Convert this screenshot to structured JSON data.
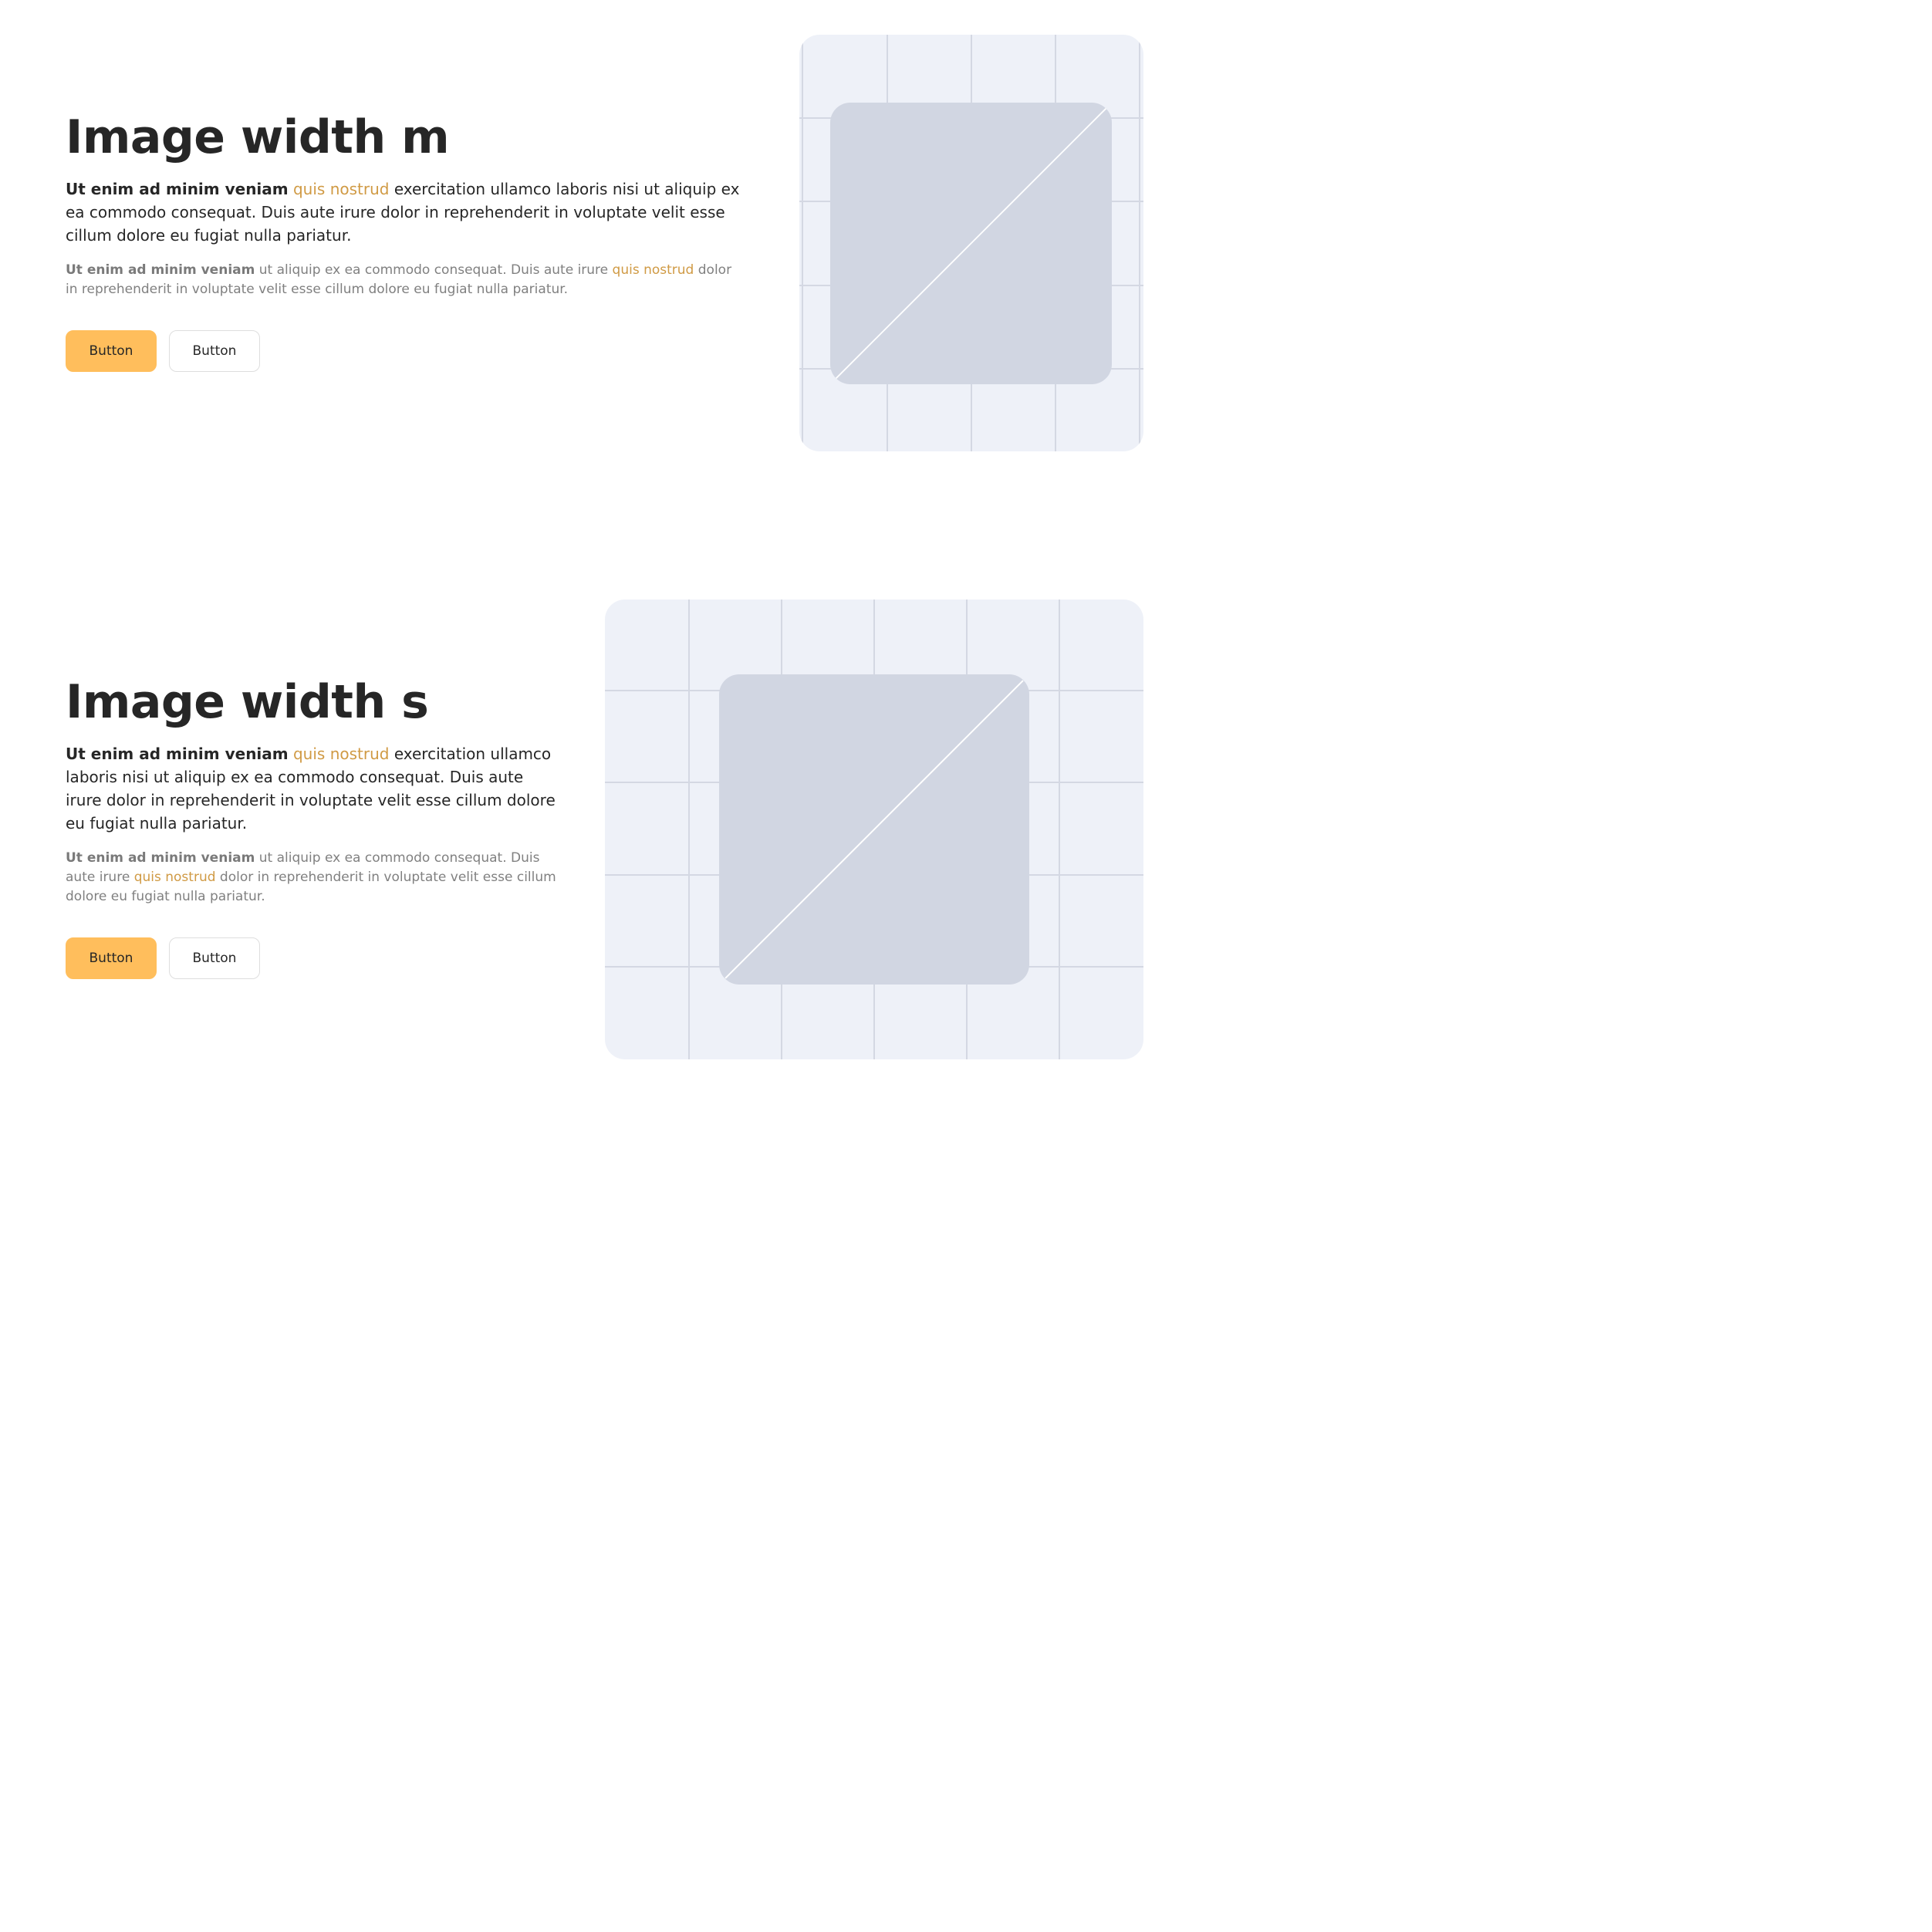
{
  "sections": [
    {
      "title": "Image width m",
      "lead": {
        "bold": "Ut enim ad minim veniam",
        "accent": "quis nostrud",
        "rest": "exercitation ullamco laboris nisi ut aliquip ex ea commodo consequat. Duis aute irure dolor in reprehenderit in voluptate velit esse cillum dolore eu fugiat nulla pariatur."
      },
      "sub": {
        "bold": "Ut enim ad minim veniam",
        "before_accent": "ut aliquip ex ea commodo consequat. Duis aute irure",
        "accent": "quis nostrud",
        "after_accent": "dolor in reprehenderit in voluptate velit esse cillum dolore eu fugiat nulla pariatur."
      },
      "primary_button": "Button",
      "secondary_button": "Button"
    },
    {
      "title": "Image width s",
      "lead": {
        "bold": "Ut enim ad minim veniam",
        "accent": "quis nostrud",
        "rest": "exercitation ullamco laboris nisi ut aliquip ex ea commodo consequat. Duis aute irure dolor in reprehenderit in voluptate velit esse cillum dolore eu fugiat nulla pariatur."
      },
      "sub": {
        "bold": "Ut enim ad minim veniam",
        "before_accent": "ut aliquip ex ea commodo consequat. Duis aute irure",
        "accent": "quis nostrud",
        "after_accent": "dolor in reprehenderit in voluptate velit esse cillum dolore eu fugiat nulla pariatur."
      },
      "primary_button": "Button",
      "secondary_button": "Button"
    }
  ],
  "colors": {
    "accent": "#d09a44",
    "primary_button": "#ffbe5c",
    "image_background": "#eef1f8",
    "image_placeholder": "#d1d6e2",
    "grid_line": "#d4d8e3",
    "text_dark": "#262626",
    "text_muted": "#808080"
  },
  "icons": {
    "image_placeholder": "image-placeholder-icon"
  }
}
